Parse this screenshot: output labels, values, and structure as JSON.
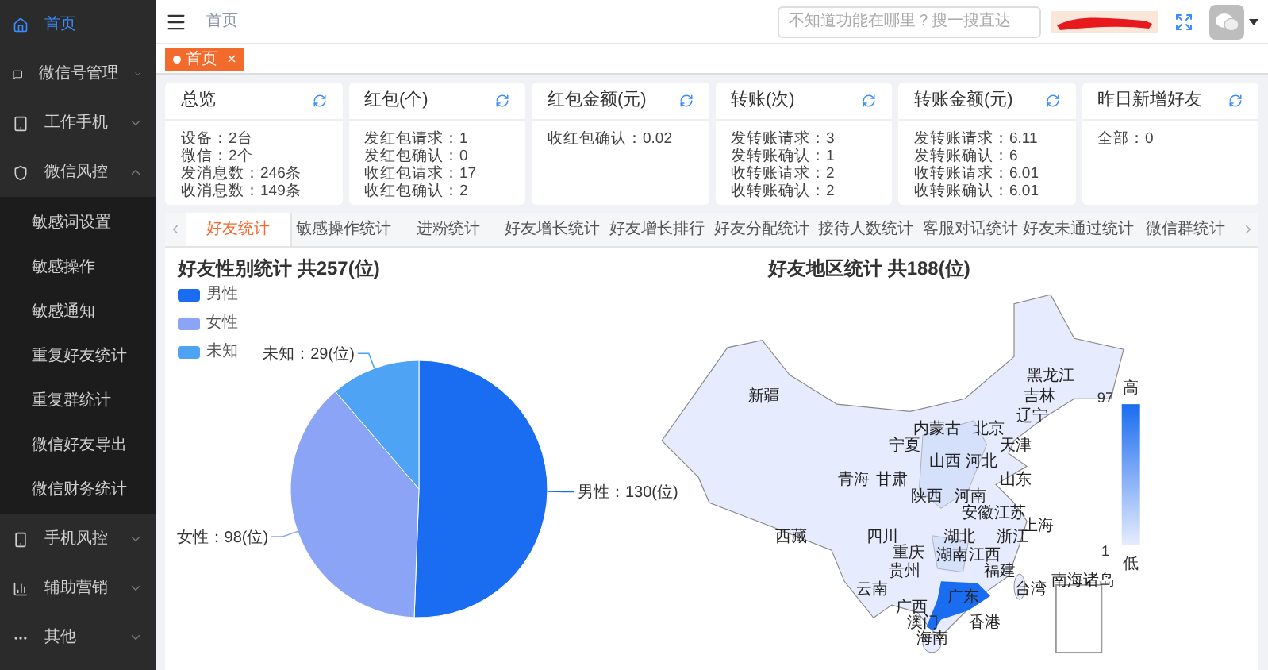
{
  "sidebar": {
    "items": [
      {
        "label": "首页",
        "selected": true
      },
      {
        "label": "微信号管理",
        "selected": false,
        "expanded": false
      },
      {
        "label": "工作手机",
        "selected": false,
        "expanded": false
      },
      {
        "label": "微信风控",
        "selected": false,
        "expanded": true,
        "children": [
          {
            "label": "敏感词设置",
            "selected": false
          },
          {
            "label": "敏感操作",
            "selected": false
          },
          {
            "label": "敏感通知",
            "selected": false
          },
          {
            "label": "重复好友统计",
            "selected": false
          },
          {
            "label": "重复群统计",
            "selected": false
          },
          {
            "label": "微信好友导出",
            "selected": false
          },
          {
            "label": "微信财务统计",
            "selected": false
          }
        ]
      },
      {
        "label": "手机风控",
        "selected": false,
        "expanded": false
      },
      {
        "label": "辅助营销",
        "selected": false,
        "expanded": false
      },
      {
        "label": "其他",
        "selected": false,
        "expanded": false
      }
    ]
  },
  "header": {
    "breadcrumb": "首页",
    "search": {
      "placeholder": "不知道功能在哪里？搜一搜直达"
    }
  },
  "open_tabs": [
    {
      "label": "首页",
      "selected": true
    }
  ],
  "cards": [
    {
      "title": "总览",
      "lines": [
        "设备：2台",
        "微信：2个",
        "发消息数：246条",
        "收消息数：149条"
      ]
    },
    {
      "title": "红包(个)",
      "lines": [
        "发红包请求：1",
        "发红包确认：0",
        "收红包请求：17",
        "收红包确认：2"
      ]
    },
    {
      "title": "红包金额(元)",
      "lines": [
        "收红包确认：0.02"
      ]
    },
    {
      "title": "转账(次)",
      "lines": [
        "发转账请求：3",
        "发转账确认：1",
        "收转账请求：2",
        "收转账确认：2"
      ]
    },
    {
      "title": "转账金额(元)",
      "lines": [
        "发转账请求：6.11",
        "发转账确认：6",
        "收转账请求：6.01",
        "收转账确认：6.01"
      ]
    },
    {
      "title": "昨日新增好友",
      "lines": [
        "全部：0"
      ]
    }
  ],
  "stat_tabs": [
    {
      "label": "好友统计",
      "selected": true
    },
    {
      "label": "敏感操作统计",
      "selected": false
    },
    {
      "label": "进粉统计",
      "selected": false
    },
    {
      "label": "好友增长统计",
      "selected": false
    },
    {
      "label": "好友增长排行",
      "selected": false
    },
    {
      "label": "好友分配统计",
      "selected": false
    },
    {
      "label": "接待人数统计",
      "selected": false
    },
    {
      "label": "客服对话统计",
      "selected": false
    },
    {
      "label": "好友未通过统计",
      "selected": false
    },
    {
      "label": "微信群统计",
      "selected": false
    }
  ],
  "gender_chart": {
    "legend": [
      {
        "color": "#1a6cf0"
      },
      {
        "color": "#8ca4f5"
      },
      {
        "color": "#4fa3f5"
      }
    ],
    "chart_data": {
      "type": "pie",
      "title": "好友性别统计 共257(位)",
      "categories": [
        "男性",
        "女性",
        "未知"
      ],
      "values": [
        130,
        98,
        29
      ],
      "value_labels": [
        "男性：130(位)",
        "女性：98(位)",
        "未知：29(位)"
      ]
    }
  },
  "region_map": {
    "title": "好友地区统计 共188(位)",
    "labels": [
      "黑龙江",
      "新疆",
      "吉林",
      "辽宁",
      "内蒙古",
      "北京",
      "宁夏",
      "天津",
      "山西",
      "河北",
      "青海",
      "甘肃",
      "山东",
      "陕西",
      "河南",
      "安徽",
      "江苏",
      "上海",
      "西藏",
      "四川",
      "湖北",
      "浙江",
      "重庆",
      "湖南",
      "江西",
      "贵州",
      "福建",
      "南海诸岛",
      "云南",
      "台湾",
      "广东",
      "广西",
      "澳门",
      "香港",
      "海南"
    ],
    "legend": {
      "high": "高",
      "low": "低",
      "max": "97",
      "min": "1"
    }
  }
}
